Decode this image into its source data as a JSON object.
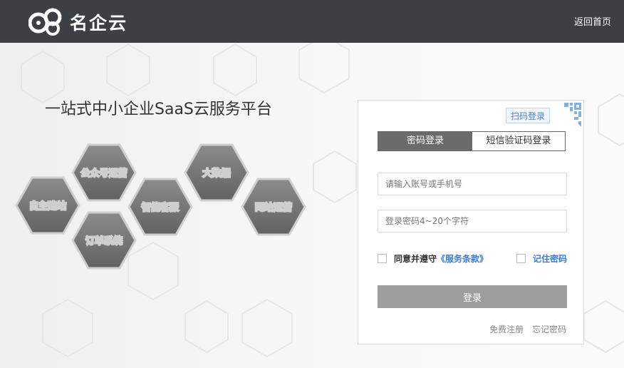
{
  "header": {
    "brand": "名企云",
    "home_link": "返回首页"
  },
  "slogan": "一站式中小企业SaaS云服务平台",
  "services": [
    "自主建站",
    "公众号运营",
    "订单系统",
    "智能客服",
    "大数据",
    "网站运营"
  ],
  "login": {
    "qr_tag": "扫码登录",
    "tabs": [
      "密码登录",
      "短信验证码登录"
    ],
    "active_tab": "密码登录",
    "account": {
      "placeholder": "请输入账号或手机号",
      "value": ""
    },
    "password": {
      "placeholder": "登录密码4~20个字符",
      "value": ""
    },
    "agree_text": "同意并遵守",
    "terms_link": "《服务条款》",
    "remember": "记住密码",
    "submit": "登录",
    "register": "免费注册",
    "forgot": "忘记密码"
  },
  "colors": {
    "header_bg": "#3c3f44",
    "hex_fill": "#7a7a7a",
    "active_tab": "#6b6b6b",
    "login_button": "#9d9d9d",
    "link": "#3a7bd5"
  },
  "icons": [
    "logo-icon",
    "qr-code-icon"
  ]
}
